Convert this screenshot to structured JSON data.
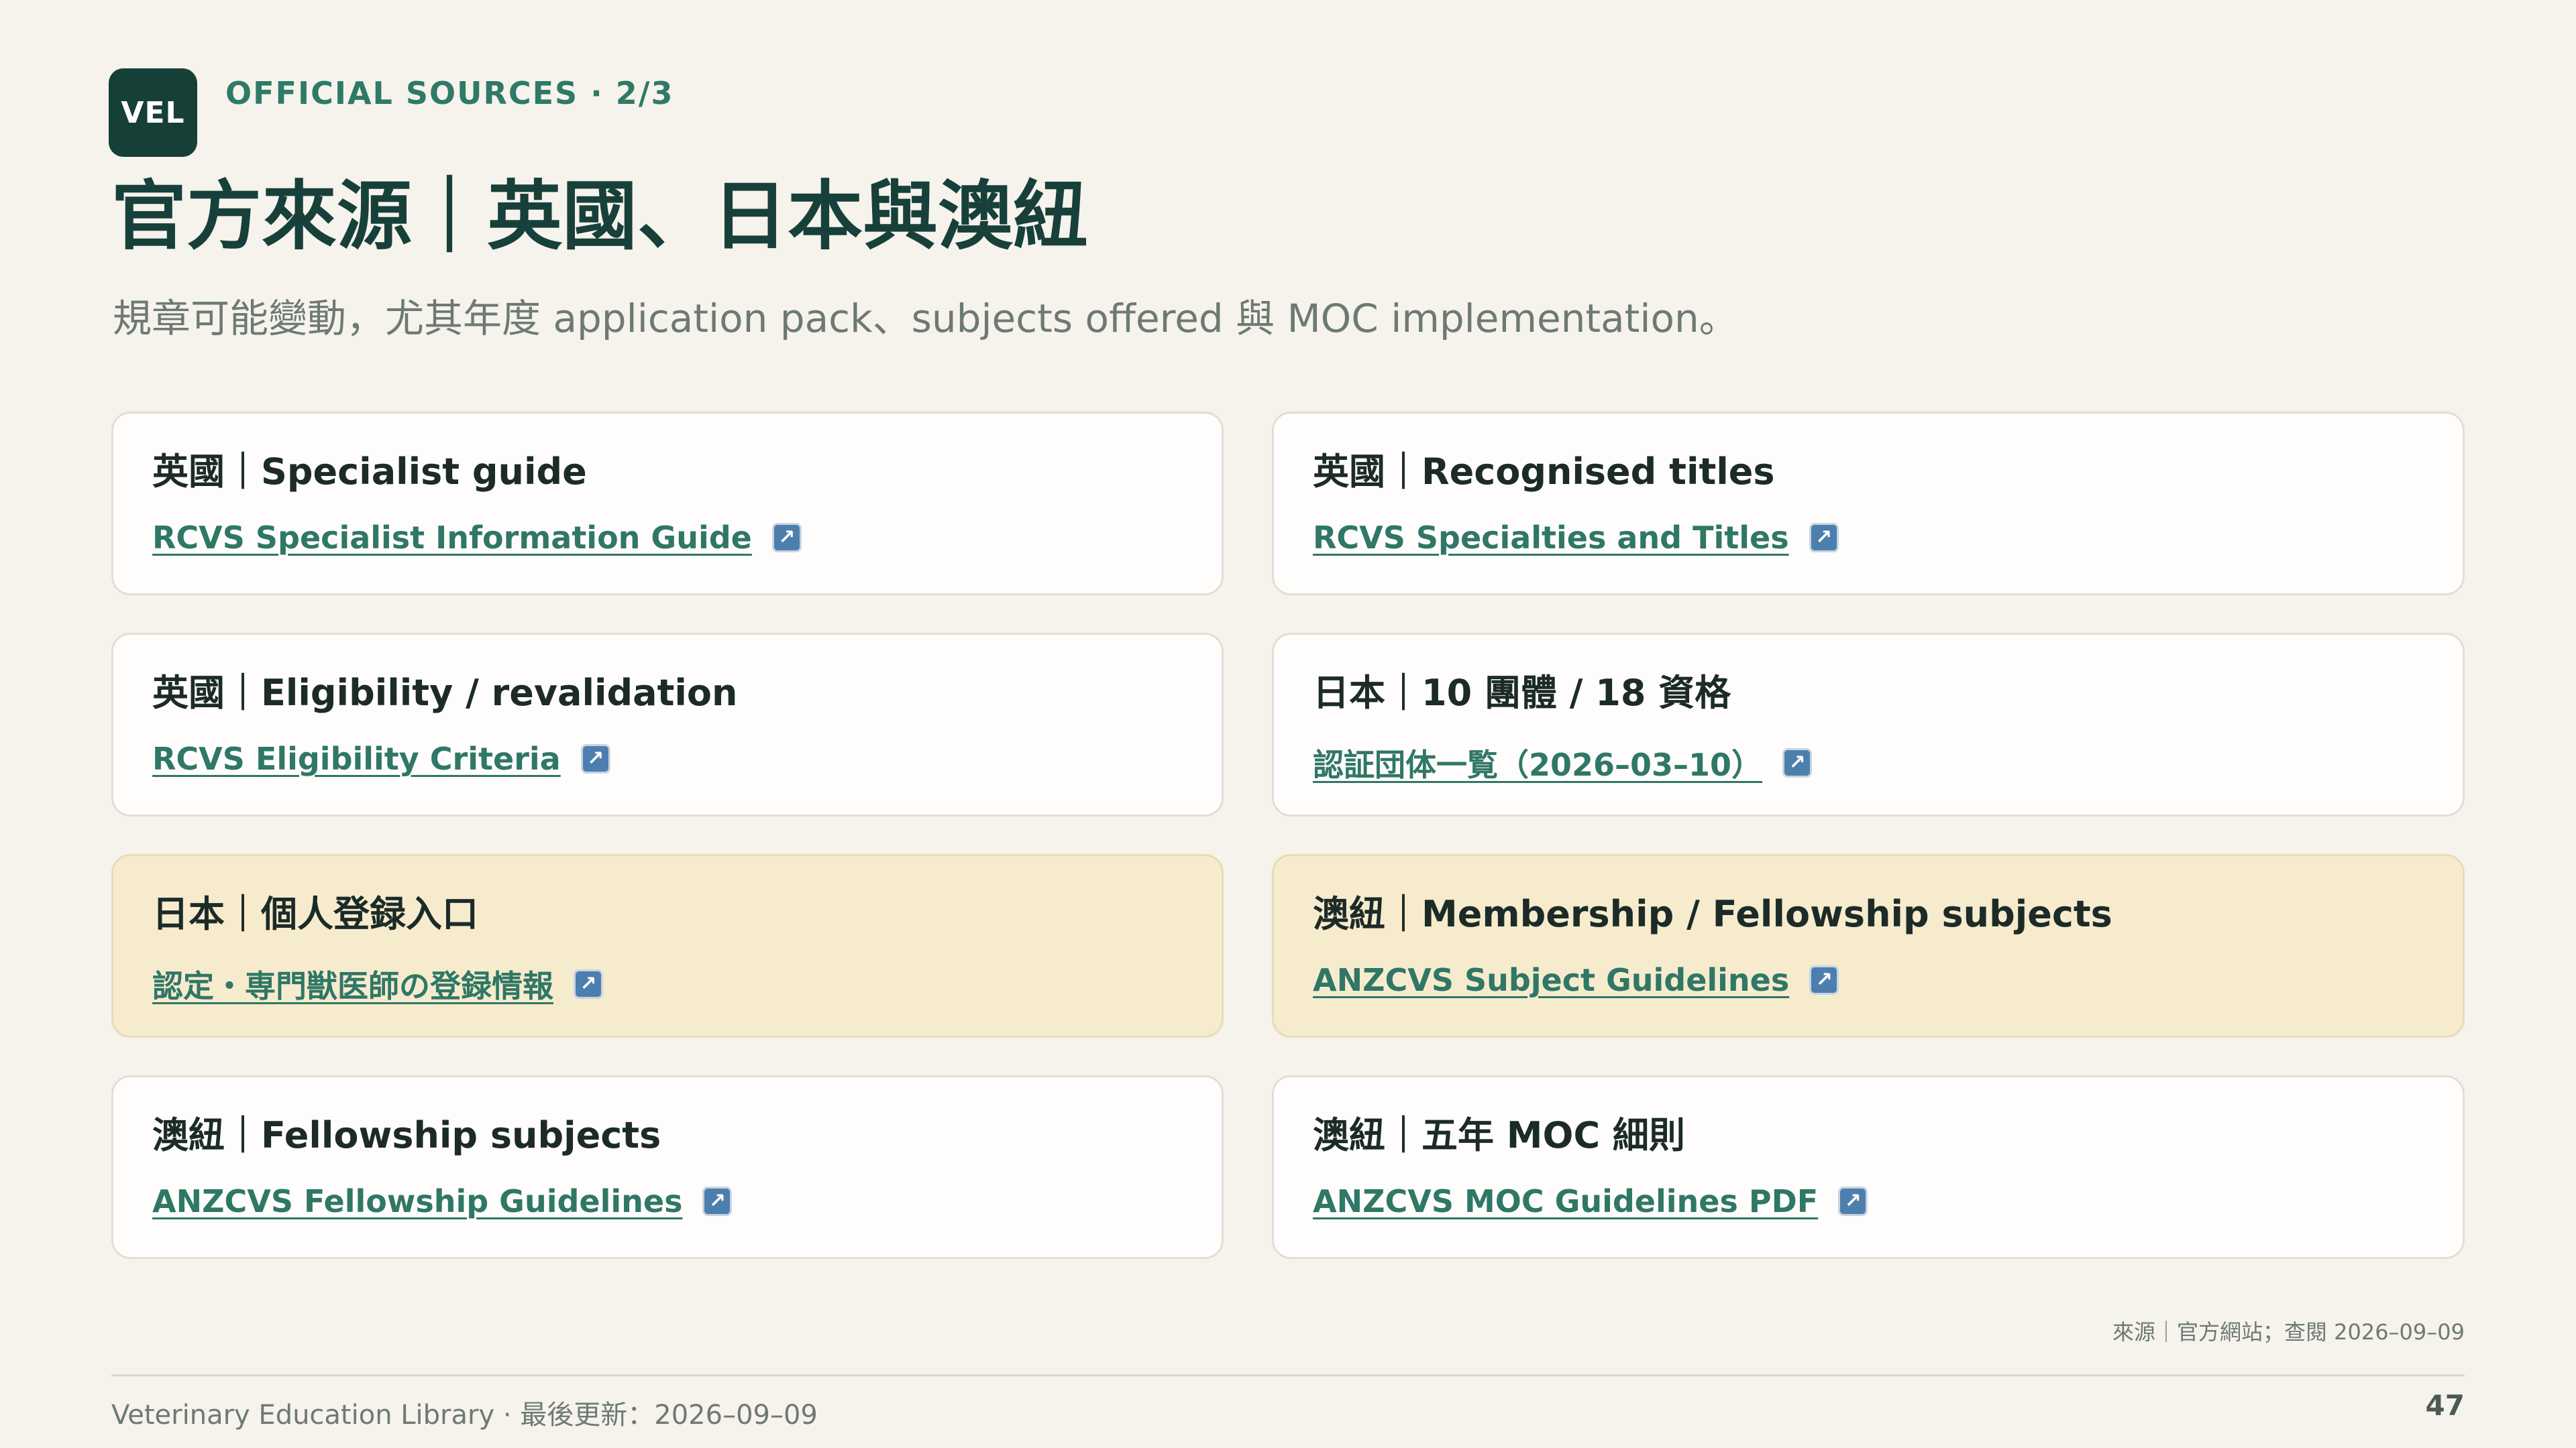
{
  "header": {
    "logo_text": "VEL",
    "eyebrow": "OFFICIAL SOURCES · 2/3",
    "title": "官方來源｜英國、日本與澳紐",
    "subtitle": "規章可能變動，尤其年度 application pack、subjects offered 與 MOC implementation。"
  },
  "cards": [
    {
      "title": "英國｜Specialist guide",
      "link": "RCVS Specialist Information Guide",
      "highlight": false
    },
    {
      "title": "英國｜Recognised titles",
      "link": "RCVS Specialties and Titles",
      "highlight": false
    },
    {
      "title": "英國｜Eligibility / revalidation",
      "link": "RCVS Eligibility Criteria",
      "highlight": false
    },
    {
      "title": "日本｜10 團體 / 18 資格",
      "link": "認証団体一覧（2026–03–10）",
      "highlight": false
    },
    {
      "title": "日本｜個人登録入口",
      "link": "認定・専門獣医師の登録情報",
      "highlight": true
    },
    {
      "title": "澳紐｜Membership / Fellowship subjects",
      "link": "ANZCVS Subject Guidelines",
      "highlight": true
    },
    {
      "title": "澳紐｜Fellowship subjects",
      "link": "ANZCVS Fellowship Guidelines",
      "highlight": false
    },
    {
      "title": "澳紐｜五年 MOC 細則",
      "link": "ANZCVS MOC Guidelines PDF",
      "highlight": false
    }
  ],
  "icons": {
    "external_link": "external-link-icon"
  },
  "source_note": "來源｜官方網站；查閱 2026–09–09",
  "footer": {
    "left": "Veterinary Education Library · 最後更新：2026–09–09",
    "page_number": "47"
  },
  "colors": {
    "background": "#f6f2ec",
    "brand": "#163f37",
    "accent": "#2e7a66",
    "highlight_card": "#f6ebcd"
  }
}
